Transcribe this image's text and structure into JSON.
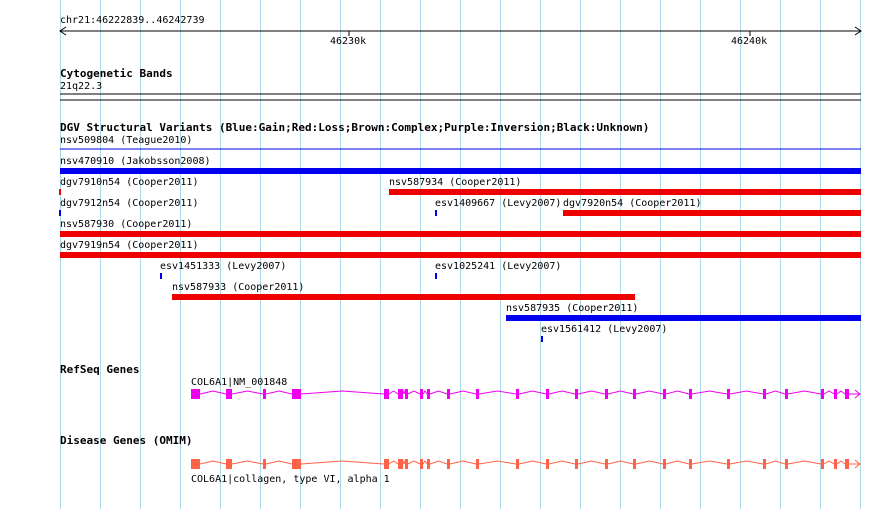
{
  "ruler": {
    "location": "chr21:46222839..46242739",
    "tick_labels": [
      "46230k",
      "46240k"
    ]
  },
  "tracks": {
    "cytoband": {
      "title": "Cytogenetic Bands",
      "band": "21q22.3"
    },
    "dgv": {
      "title": "DGV Structural Variants (Blue:Gain;Red:Loss;Brown:Complex;Purple:Inversion;Black:Unknown)",
      "variants": [
        {
          "label": "nsv509804 (Teague2010)",
          "type": "none"
        },
        {
          "label": "nsv470910 (Jakobsson2008)",
          "type": "gain"
        },
        {
          "label": "dgv7910n54 (Cooper2011)",
          "type": "loss"
        },
        {
          "label": "nsv587934 (Cooper2011)",
          "type": "loss"
        },
        {
          "label": "dgv7912n54 (Cooper2011)",
          "type": "gain"
        },
        {
          "label": "esv1409667 (Levy2007)",
          "type": "gain"
        },
        {
          "label": "dgv7920n54 (Cooper2011)",
          "type": "loss"
        },
        {
          "label": "nsv587930 (Cooper2011)",
          "type": "loss"
        },
        {
          "label": "dgv7919n54 (Cooper2011)",
          "type": "loss"
        },
        {
          "label": "esv1451333 (Levy2007)",
          "type": "gain"
        },
        {
          "label": "esv1025241 (Levy2007)",
          "type": "gain"
        },
        {
          "label": "nsv587933 (Cooper2011)",
          "type": "loss"
        },
        {
          "label": "nsv587935 (Cooper2011)",
          "type": "gain"
        },
        {
          "label": "esv1561412 (Levy2007)",
          "type": "gain"
        }
      ]
    },
    "refseq": {
      "title": "RefSeq Genes",
      "gene_label": "COL6A1|NM_001848"
    },
    "omim": {
      "title": "Disease Genes (OMIM)",
      "gene_label": "COL6A1|collagen, type VI, alpha 1"
    }
  },
  "colors": {
    "gain": "#0000ee",
    "loss": "#ee0000",
    "refseq": "#ee00ee",
    "omim": "#ff6347",
    "grid": "#add8e6"
  }
}
